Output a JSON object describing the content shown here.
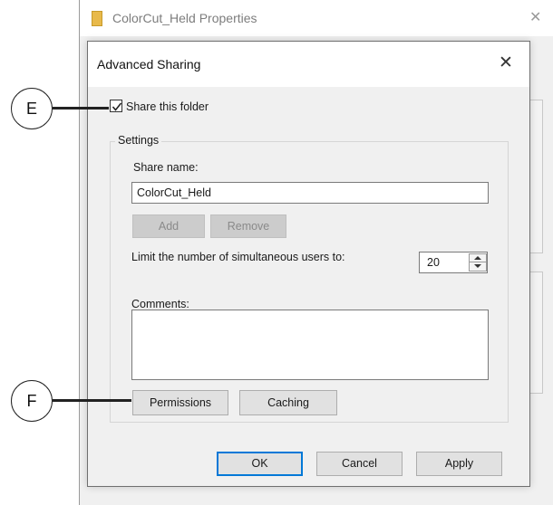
{
  "properties_window": {
    "title": "ColorCut_Held Properties",
    "close_symbol": "✕"
  },
  "dialog": {
    "title": "Advanced Sharing",
    "close_symbol": "✕",
    "share_checkbox": {
      "label": "Share this folder",
      "checked": true
    },
    "settings": {
      "legend": "Settings",
      "share_name_label": "Share name:",
      "share_name_value": "ColorCut_Held",
      "add_label": "Add",
      "remove_label": "Remove",
      "limit_label": "Limit the number of simultaneous users to:",
      "limit_value": "20",
      "comments_label": "Comments:",
      "comments_value": "",
      "permissions_label": "Permissions",
      "caching_label": "Caching"
    },
    "footer": {
      "ok_label": "OK",
      "cancel_label": "Cancel",
      "apply_label": "Apply"
    }
  },
  "callouts": [
    {
      "letter": "E",
      "target": "share-checkbox"
    },
    {
      "letter": "F",
      "target": "permissions-button"
    }
  ],
  "colors": {
    "dialog_bg": "#f0f0f0",
    "titlebar_bg": "#ffffff",
    "default_button_border": "#0078d7",
    "folder_icon": "#e8b94a"
  },
  "icons": [
    "folder-icon",
    "close-icon",
    "checkmark-icon",
    "spin-up-arrow-icon",
    "spin-down-arrow-icon"
  ]
}
